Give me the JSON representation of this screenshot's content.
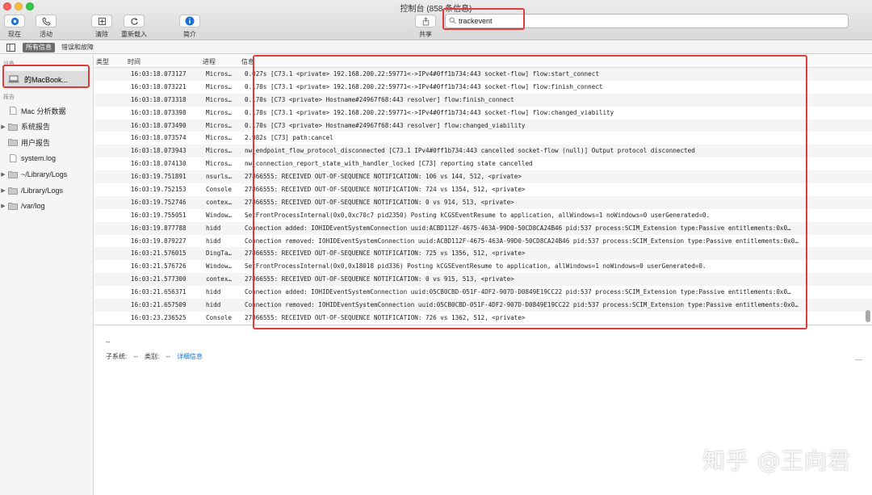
{
  "window": {
    "title": "控制台 (858 条信息)"
  },
  "toolbar": {
    "now_label": "现在",
    "activity_label": "活动",
    "clear_label": "清除",
    "reload_label": "重新载入",
    "info_label": "简介",
    "share_label": "共享"
  },
  "search": {
    "value": "trackevent"
  },
  "filter": {
    "all_label": "所有信息",
    "errors_label": "错误和故障"
  },
  "sidebar": {
    "devices_header": "设备",
    "device_name": "  的MacBook...",
    "reports_header": "报告",
    "items": [
      {
        "label": "Mac 分析数据",
        "expandable": false,
        "icon": "document-icon"
      },
      {
        "label": "系统报告",
        "expandable": true,
        "icon": "folder-icon"
      },
      {
        "label": "用户报告",
        "expandable": false,
        "icon": "folder-icon"
      },
      {
        "label": "system.log",
        "expandable": false,
        "icon": "document-icon"
      },
      {
        "label": "~/Library/Logs",
        "expandable": true,
        "icon": "folder-icon"
      },
      {
        "label": "/Library/Logs",
        "expandable": true,
        "icon": "folder-icon"
      },
      {
        "label": "/var/log",
        "expandable": true,
        "icon": "folder-icon"
      }
    ]
  },
  "table": {
    "headers": {
      "type": "类型",
      "time": "时间",
      "process": "进程",
      "message": "信息"
    },
    "rows": [
      {
        "time": "16:03:18.073127",
        "process": "Micros…",
        "message": "0.027s [C73.1 <private> 192.168.200.22:59771<->IPv4#0ff1b734:443 socket-flow] flow:start_connect"
      },
      {
        "time": "16:03:18.073221",
        "process": "Micros…",
        "message": "0.170s [C73.1 <private> 192.168.200.22:59771<->IPv4#0ff1b734:443 socket-flow] flow:finish_connect"
      },
      {
        "time": "16:03:18.073318",
        "process": "Micros…",
        "message": "0.170s [C73 <private> Hostname#24967f68:443 resolver] flow:finish_connect"
      },
      {
        "time": "16:03:18.073398",
        "process": "Micros…",
        "message": "0.170s [C73.1 <private> 192.168.200.22:59771<->IPv4#0ff1b734:443 socket-flow] flow:changed_viability"
      },
      {
        "time": "16:03:18.073490",
        "process": "Micros…",
        "message": "0.170s [C73 <private> Hostname#24967f68:443 resolver] flow:changed_viability"
      },
      {
        "time": "16:03:18.073574",
        "process": "Micros…",
        "message": "2.982s [C73] path:cancel"
      },
      {
        "time": "16:03:18.073943",
        "process": "Micros…",
        "message": "nw_endpoint_flow_protocol_disconnected [C73.1 IPv4#0ff1b734:443 cancelled socket-flow (null)] Output protocol disconnected"
      },
      {
        "time": "16:03:18.074130",
        "process": "Micros…",
        "message": "nw_connection_report_state_with_handler_locked [C73] reporting state cancelled"
      },
      {
        "time": "16:03:19.751891",
        "process": "nsurls…",
        "message": "27866555: RECEIVED OUT-OF-SEQUENCE NOTIFICATION: 106 vs 144, 512, <private>"
      },
      {
        "time": "16:03:19.752153",
        "process": "Console",
        "message": "27866555: RECEIVED OUT-OF-SEQUENCE NOTIFICATION: 724 vs 1354, 512, <private>"
      },
      {
        "time": "16:03:19.752746",
        "process": "contex…",
        "message": "27866555: RECEIVED OUT-OF-SEQUENCE NOTIFICATION: 0 vs 914, 513, <private>"
      },
      {
        "time": "16:03:19.755051",
        "process": "Window…",
        "message": "SetFrontProcessInternal(0x0,0xc70c7 pid2350) Posting kCGSEventResume to application, allWindows=1 noWindows=0 userGenerated=0."
      },
      {
        "time": "16:03:19.877788",
        "process": "hidd",
        "message": "Connection added: IOHIDEventSystemConnection uuid:ACBD112F-4675-463A-99D0-50CD8CA24B46 pid:537 process:SCIM_Extension type:Passive entitlements:0x0…"
      },
      {
        "time": "16:03:19.879227",
        "process": "hidd",
        "message": "Connection removed: IOHIDEventSystemConnection uuid:ACBD112F-4675-463A-99D0-50CD8CA24B46 pid:537 process:SCIM_Extension type:Passive entitlements:0x0…"
      },
      {
        "time": "16:03:21.576015",
        "process": "DingTa…",
        "message": "27866555: RECEIVED OUT-OF-SEQUENCE NOTIFICATION: 725 vs 1356, 512, <private>"
      },
      {
        "time": "16:03:21.576726",
        "process": "Window…",
        "message": "SetFrontProcessInternal(0x0,0x18018 pid336) Posting kCGSEventResume to application, allWindows=1 noWindows=0 userGenerated=0."
      },
      {
        "time": "16:03:21.577300",
        "process": "contex…",
        "message": "27866555: RECEIVED OUT-OF-SEQUENCE NOTIFICATION: 0 vs 915, 513, <private>"
      },
      {
        "time": "16:03:21.656371",
        "process": "hidd",
        "message": "Connection added: IOHIDEventSystemConnection uuid:05CB0CBD-051F-4DF2-907D-D0849E19CC22 pid:537 process:SCIM_Extension type:Passive entitlements:0x0…"
      },
      {
        "time": "16:03:21.657509",
        "process": "hidd",
        "message": "Connection removed: IOHIDEventSystemConnection uuid:05CB0CBD-051F-4DF2-907D-D0849E19CC22 pid:537 process:SCIM_Extension type:Passive entitlements:0x0…"
      },
      {
        "time": "16:03:23.236525",
        "process": "Console",
        "message": "27866555: RECEIVED OUT-OF-SEQUENCE NOTIFICATION: 726 vs 1362, 512, <private>"
      }
    ]
  },
  "detail": {
    "dashes": "--",
    "subsystem_label": "子系统:",
    "subsystem_value": "--",
    "category_label": "类别:",
    "category_value": "--",
    "details_link": "详细信息",
    "end_mark": "—"
  },
  "watermark": "知乎 @王向君",
  "colors": {
    "highlight_border": "#e23b3b",
    "link": "#1a6fd1",
    "info_icon": "#1a6fd1"
  }
}
